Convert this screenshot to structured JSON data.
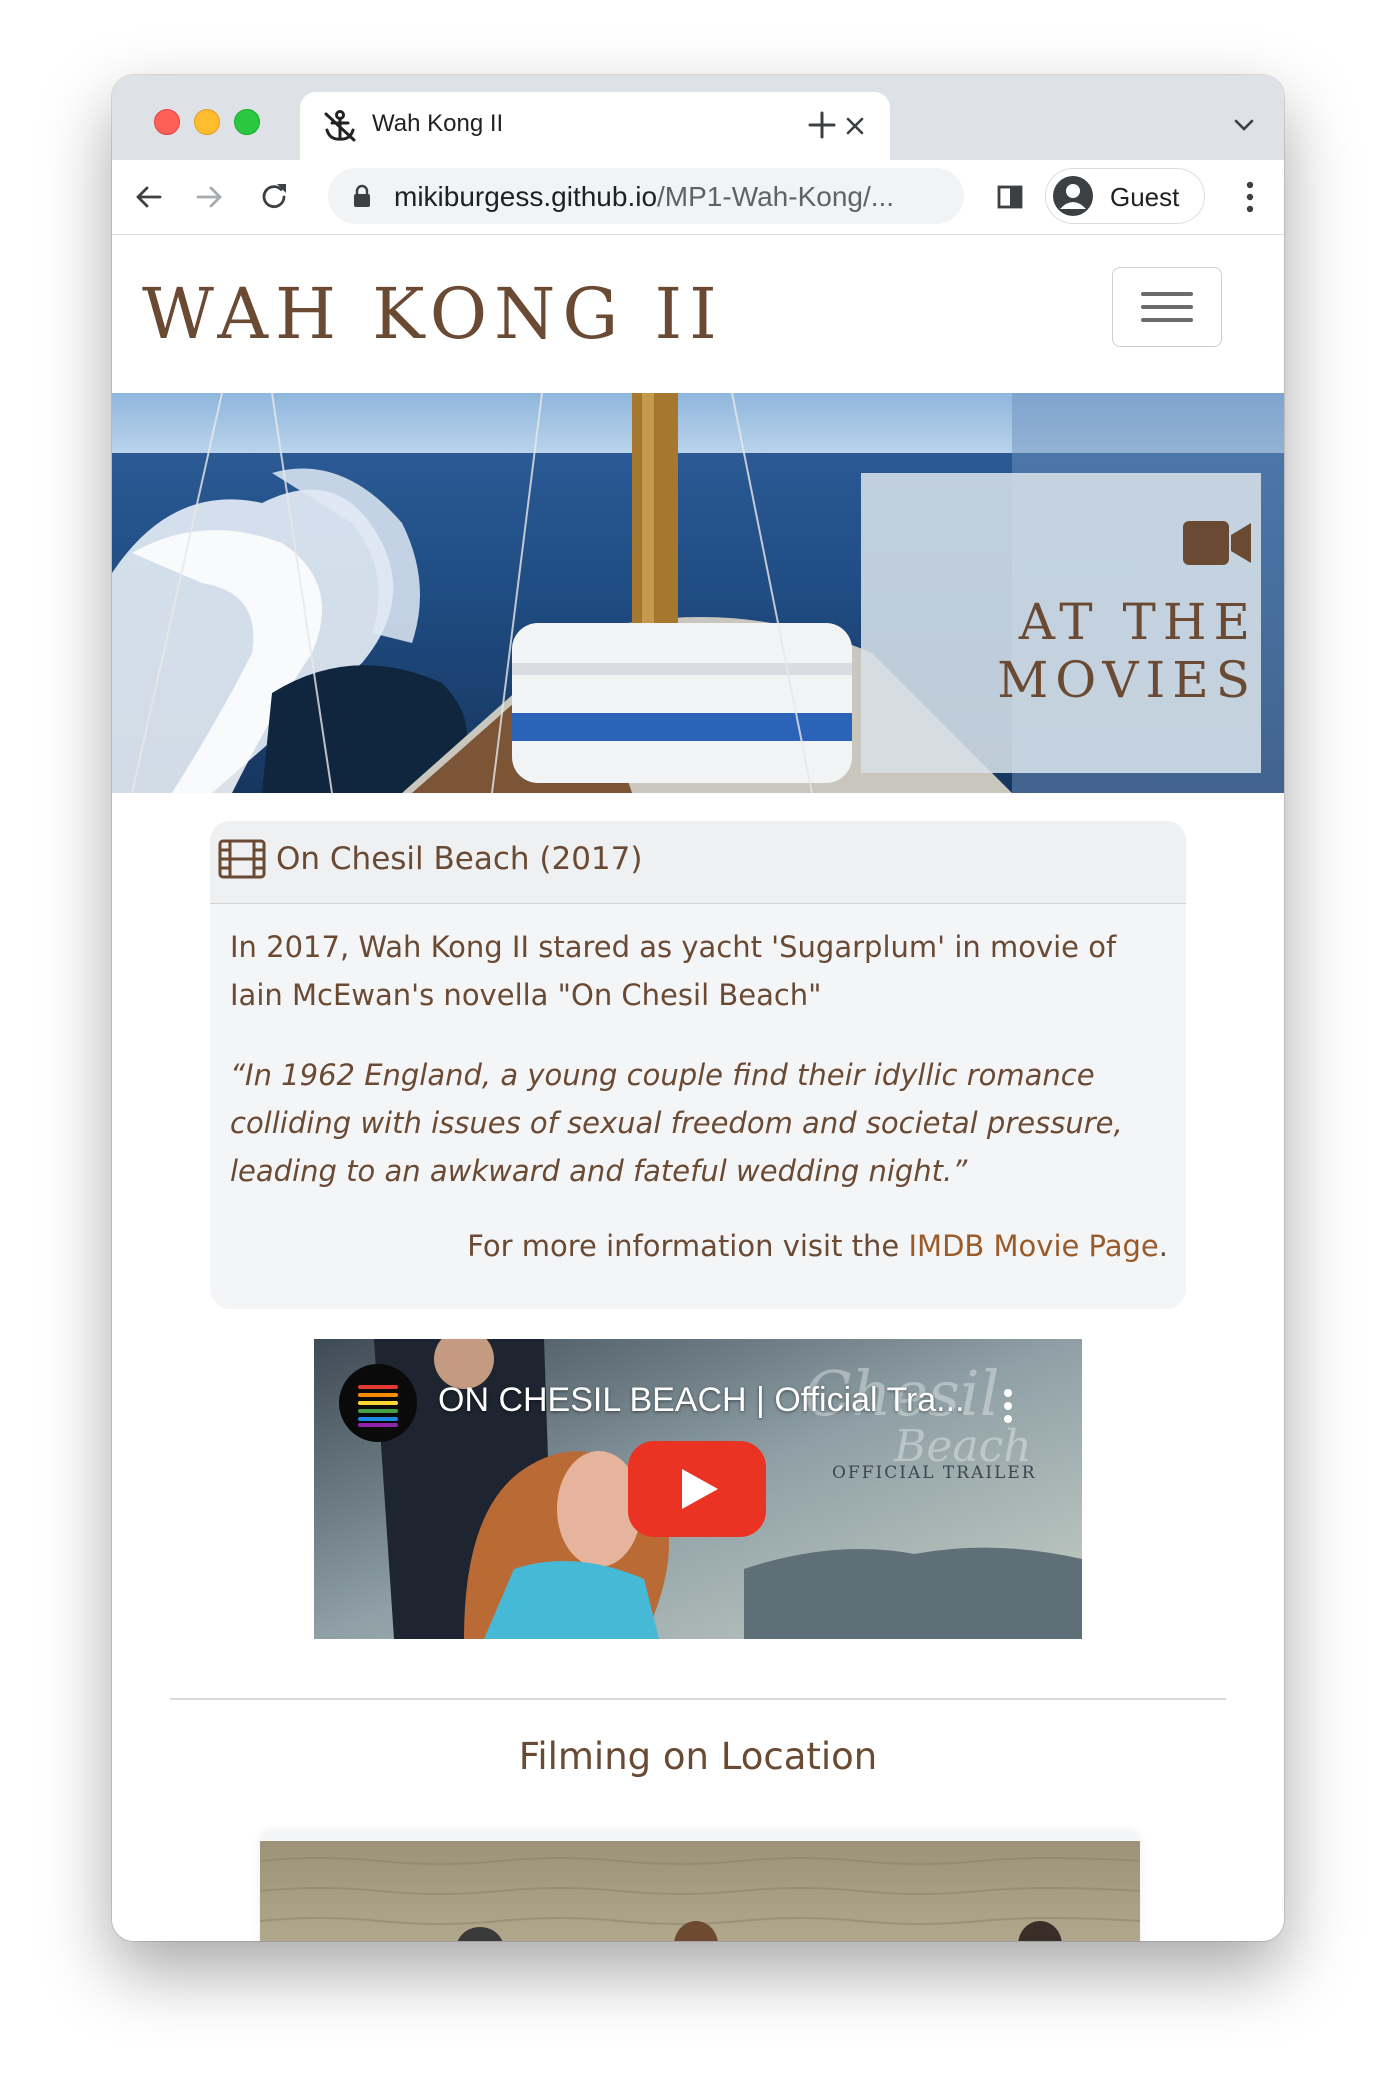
{
  "browser": {
    "tab_title": "Wah Kong II",
    "url_domain": "mikiburgess.github.io",
    "url_path": "/MP1-Wah-Kong/...",
    "profile_label": "Guest"
  },
  "navbar": {
    "brand": "WAH KONG II"
  },
  "hero": {
    "title_line1": "AT THE",
    "title_line2": "MOVIES"
  },
  "card": {
    "title": "On Chesil Beach (2017)",
    "body": "In 2017, Wah Kong II stared as yacht 'Sugarplum' in movie of Iain McEwan's novella \"On Chesil Beach\"",
    "quote": "“In 1962 England, a young couple find their idyllic romance colliding with issues of sexual freedom and societal pressure, leading to an awkward and fateful wedding night.”",
    "more_prefix": "For more information visit the ",
    "more_link": "IMDB Movie Page",
    "more_suffix": "."
  },
  "video": {
    "title": "ON CHESIL BEACH | Official Tra...",
    "brand_line1": "Chesil",
    "brand_line2": "Beach",
    "trailer_label": "OFFICIAL TRAILER"
  },
  "section": {
    "title": "Filming on Location"
  },
  "colors": {
    "brand_brown": "#6b4a34",
    "link_brown": "#9a5b2a",
    "card_bg": "#f4f5f7",
    "youtube_red": "#ea3323"
  }
}
